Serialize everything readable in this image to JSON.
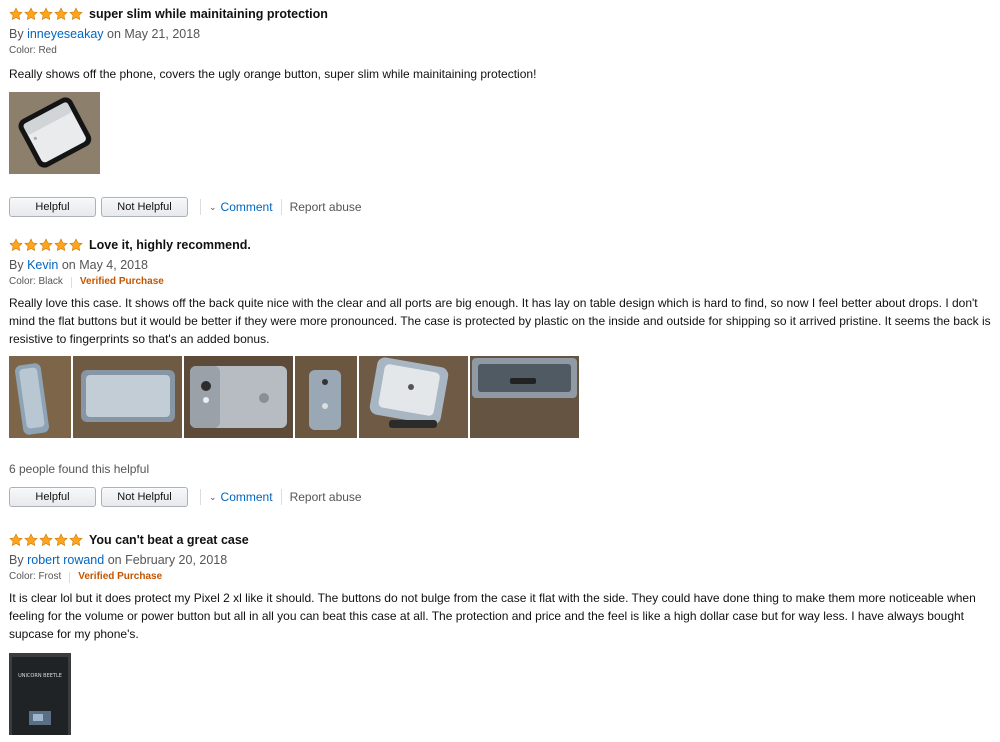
{
  "reviews": [
    {
      "rating": 5,
      "title": "super slim while mainitaining protection",
      "by": "By",
      "author": "inneyeseakay",
      "date": "on May 21, 2018",
      "color": "Color: Red",
      "verified": "",
      "body": "Really shows off the phone, covers the ugly orange button, super slim while mainitaining protection!",
      "images": [
        "phone-case-photo"
      ],
      "helpful_count": "",
      "actions": {
        "helpful": "Helpful",
        "not_helpful": "Not Helpful",
        "comment": "Comment",
        "report": "Report abuse"
      }
    },
    {
      "rating": 5,
      "title": "Love it, highly recommend.",
      "by": "By",
      "author": "Kevin",
      "date": "on May 4, 2018",
      "color": "Color: Black",
      "verified": "Verified Purchase",
      "body": "Really love this case. It shows off the back quite nice with the clear and all ports are big enough. It has lay on table design which is hard to find, so now I feel better about drops. I don't mind the flat buttons but it would be better if they were more pronounced. The case is protected by plastic on the inside and outside for shipping so it arrived pristine. It seems the back is resistive to fingerprints so that's an added bonus.",
      "images": [
        "case-photo-1",
        "case-photo-2",
        "case-photo-3",
        "case-photo-4",
        "case-photo-5",
        "case-photo-6"
      ],
      "helpful_count": "6 people found this helpful",
      "actions": {
        "helpful": "Helpful",
        "not_helpful": "Not Helpful",
        "comment": "Comment",
        "report": "Report abuse"
      }
    },
    {
      "rating": 5,
      "title": "You can't beat a great case",
      "by": "By",
      "author": "robert rowand",
      "date": "on February 20, 2018",
      "color": "Color: Frost",
      "verified": "Verified Purchase",
      "body": "It is clear lol but it does protect my Pixel 2 xl like it should. The buttons do not bulge from the case it flat with the side. They could have done thing to make them more noticeable when feeling for the volume or power button but all in all you can beat this case at all. The protection and price and the feel is like a high dollar case but for way less. I have always bought supcase for my phone's.",
      "images": [
        "case-box-photo"
      ],
      "box_text": "UNICORN BEETLE",
      "helpful_count": "",
      "actions": null
    }
  ],
  "colors": {
    "star": "#ffa41c",
    "link": "#0066c0",
    "verified": "#c45500"
  }
}
